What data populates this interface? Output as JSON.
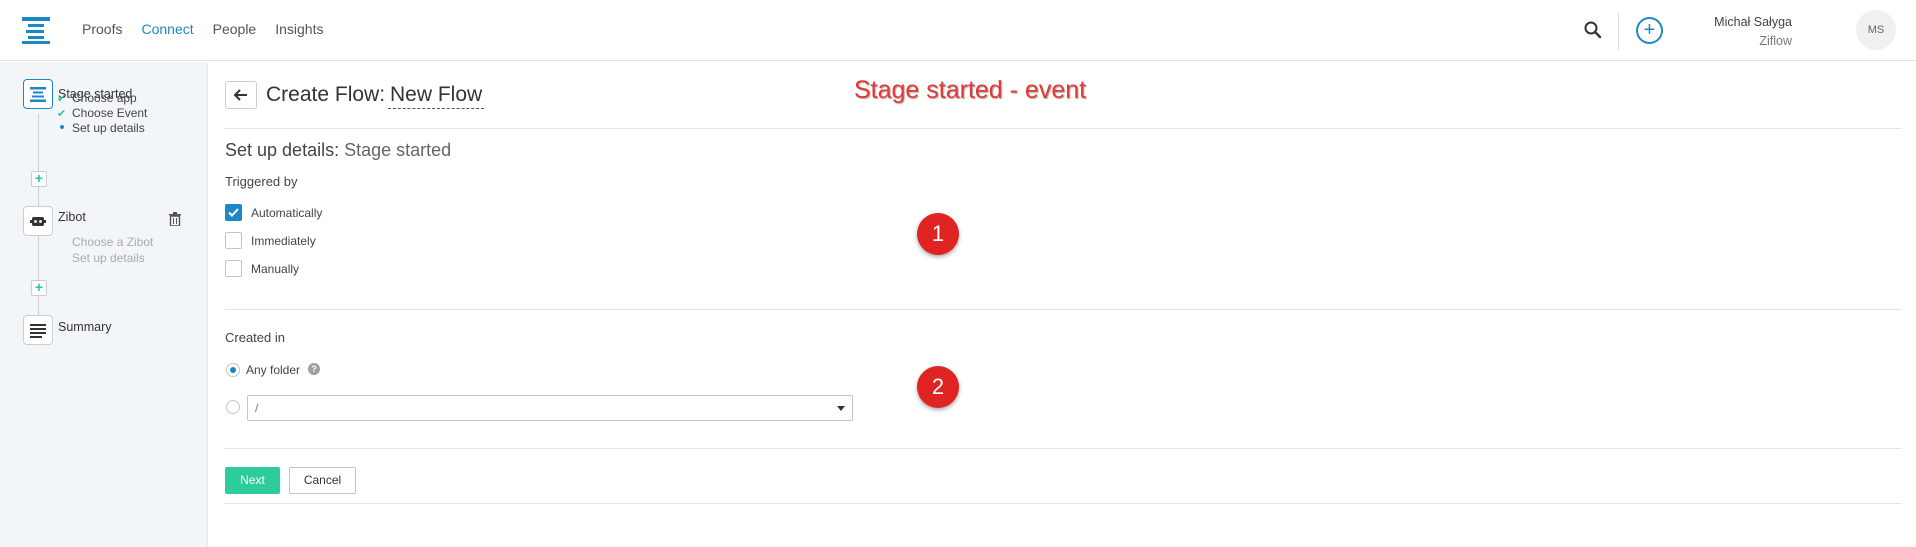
{
  "nav": {
    "items": [
      {
        "label": "Proofs",
        "active": false
      },
      {
        "label": "Connect",
        "active": true
      },
      {
        "label": "People",
        "active": false
      },
      {
        "label": "Insights",
        "active": false
      }
    ]
  },
  "user": {
    "name": "Michał Sałyga",
    "org": "Ziflow",
    "initials": "MS"
  },
  "sidebar": {
    "steps": [
      {
        "title": "Stage started",
        "substeps": [
          "Choose app",
          "Choose Event",
          "Set up details"
        ]
      },
      {
        "title": "Zibot",
        "substeps": [
          "Choose a Zibot",
          "Set up details"
        ]
      },
      {
        "title": "Summary"
      }
    ]
  },
  "header": {
    "title_prefix": "Create Flow:",
    "flow_name": "New Flow"
  },
  "annotation": {
    "title": "Stage started - event",
    "badges": [
      "1",
      "2"
    ]
  },
  "section": {
    "title": "Set up details:",
    "subtitle": "Stage started"
  },
  "triggered_by": {
    "label": "Triggered by",
    "options": [
      {
        "label": "Automatically",
        "checked": true
      },
      {
        "label": "Immediately",
        "checked": false
      },
      {
        "label": "Manually",
        "checked": false
      }
    ]
  },
  "created_in": {
    "label": "Created in",
    "any_folder_label": "Any folder",
    "help_glyph": "?",
    "folder_value": "/"
  },
  "buttons": {
    "next": "Next",
    "cancel": "Cancel"
  },
  "colors": {
    "accent": "#1e88c7",
    "primary_button": "#2ecc9b",
    "annotation": "#e53935"
  }
}
